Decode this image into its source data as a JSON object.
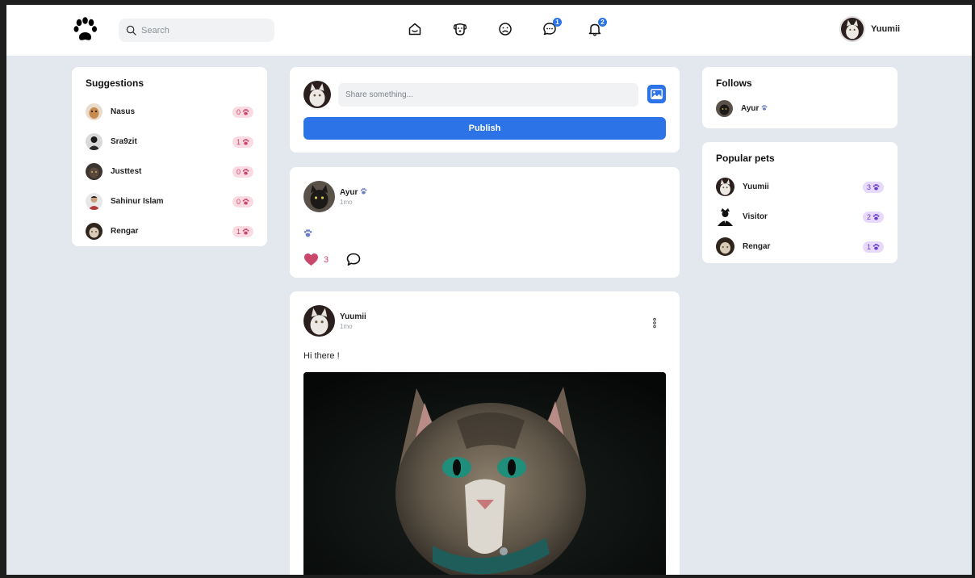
{
  "header": {
    "search_placeholder": "Search",
    "messages_badge": "1",
    "notifications_badge": "2",
    "user_name": "Yuumii"
  },
  "suggestions": {
    "title": "Suggestions",
    "items": [
      {
        "name": "Nasus",
        "count": "0"
      },
      {
        "name": "Sra9zit",
        "count": "1"
      },
      {
        "name": "Justtest",
        "count": "0"
      },
      {
        "name": "Sahinur Islam",
        "count": "0"
      },
      {
        "name": "Rengar",
        "count": "1"
      }
    ]
  },
  "composer": {
    "placeholder": "Share something...",
    "publish_label": "Publish"
  },
  "posts": [
    {
      "author": "Ayur",
      "time": "1mo",
      "likes": "3"
    },
    {
      "author": "Yuumii",
      "time": "1mo",
      "text": "Hi there !"
    }
  ],
  "follows": {
    "title": "Follows",
    "items": [
      {
        "name": "Ayur"
      }
    ]
  },
  "popular": {
    "title": "Popular pets",
    "items": [
      {
        "name": "Yuumii",
        "count": "3"
      },
      {
        "name": "Visitor",
        "count": "2"
      },
      {
        "name": "Rengar",
        "count": "1"
      }
    ]
  },
  "colors": {
    "accent": "#2c73e8",
    "page_bg": "#e3e7ee",
    "heart": "#c9476a",
    "pill_pink": "#fbdbe3",
    "pill_purple": "#e7dafc"
  }
}
